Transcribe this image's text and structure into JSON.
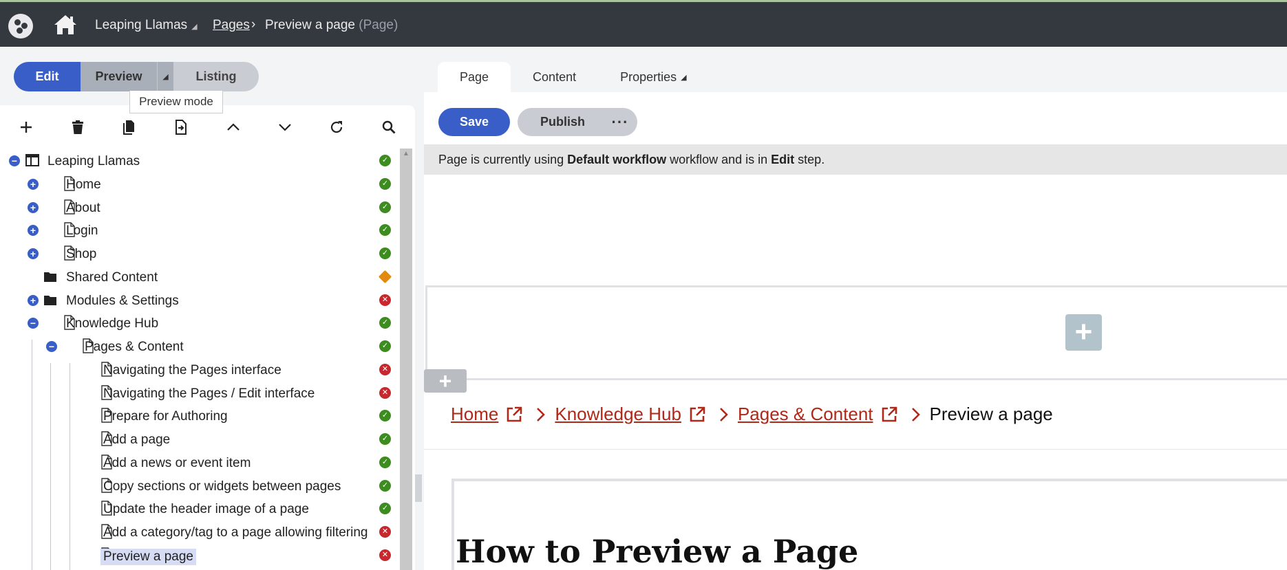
{
  "topbar": {
    "site_name": "Leaping Llamas",
    "breadcrumb_pages": "Pages",
    "breadcrumb_current": "Preview a page",
    "breadcrumb_type": "(Page)"
  },
  "modes": {
    "edit": "Edit",
    "preview": "Preview",
    "listing": "Listing",
    "tooltip": "Preview mode"
  },
  "toolbar_icons": [
    "add-icon",
    "delete-icon",
    "copy-icon",
    "move-icon",
    "move-up-icon",
    "move-down-icon",
    "refresh-icon",
    "search-icon"
  ],
  "tree": [
    {
      "label": "Leaping Llamas",
      "status": "ok"
    },
    {
      "label": "Home",
      "status": "ok"
    },
    {
      "label": "About",
      "status": "ok"
    },
    {
      "label": "Login",
      "status": "ok"
    },
    {
      "label": "Shop",
      "status": "ok"
    },
    {
      "label": "Shared Content",
      "status": "warn"
    },
    {
      "label": "Modules & Settings",
      "status": "err"
    },
    {
      "label": "Knowledge Hub",
      "status": "ok"
    },
    {
      "label": "Pages & Content",
      "status": "ok"
    },
    {
      "label": "Navigating the Pages interface",
      "status": "err"
    },
    {
      "label": "Navigating the Pages / Edit interface",
      "status": "err"
    },
    {
      "label": "Prepare for Authoring",
      "status": "ok"
    },
    {
      "label": "Add a page",
      "status": "ok"
    },
    {
      "label": "Add a news or event item",
      "status": "ok"
    },
    {
      "label": "Copy sections or widgets between pages",
      "status": "ok"
    },
    {
      "label": "Update the header image of a page",
      "status": "ok"
    },
    {
      "label": "Add a category/tag to a page allowing filtering",
      "status": "err"
    },
    {
      "label": "Preview a page",
      "status": "err"
    }
  ],
  "tabs": {
    "page": "Page",
    "content": "Content",
    "properties": "Properties"
  },
  "actions": {
    "save": "Save",
    "publish": "Publish",
    "more": "···"
  },
  "workflow": {
    "prefix": "Page is currently using",
    "name": "Default workflow",
    "middle": "workflow and is in",
    "step": "Edit",
    "suffix": "step."
  },
  "page_breadcrumb": {
    "home": "Home",
    "knowledge_hub": "Knowledge Hub",
    "pages_content": "Pages & Content",
    "current": "Preview a page"
  },
  "page_heading": "How to Preview a Page",
  "colors": {
    "primary": "#3a5ec7",
    "topbar": "#34383f",
    "link": "#b02818",
    "ok": "#3c8c1f",
    "error": "#c8282d",
    "warning": "#e08a13"
  }
}
